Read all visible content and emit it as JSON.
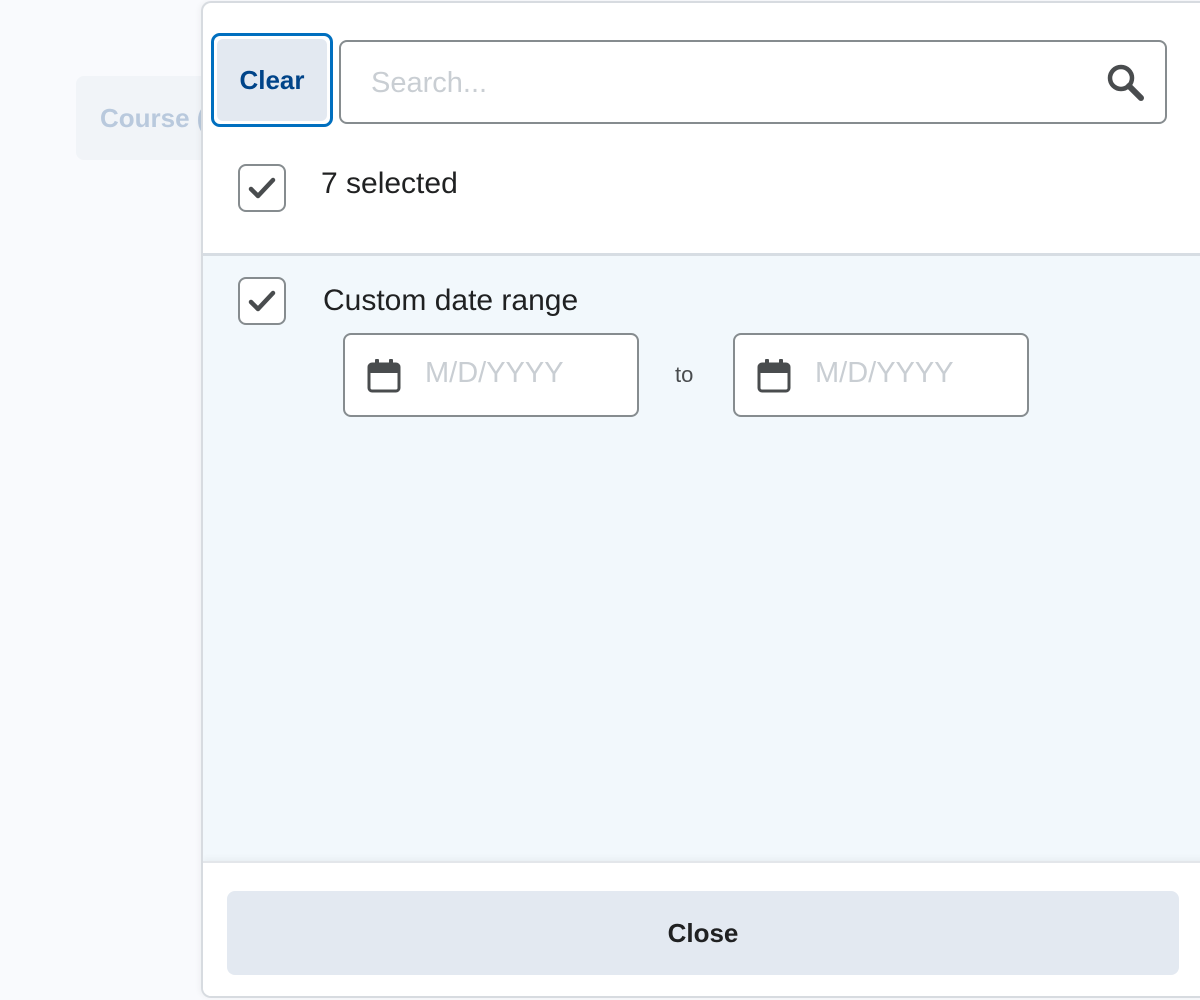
{
  "background": {
    "course_chip_label": "Course ("
  },
  "filter_panel": {
    "clear_label": "Clear",
    "search": {
      "placeholder": "Search...",
      "value": ""
    },
    "select_all": {
      "checked": true,
      "label": "7 selected"
    },
    "options": [
      {
        "label": "Custom date range",
        "checked": true,
        "date_range": {
          "start_placeholder": "M/D/YYYY",
          "start_value": "",
          "separator": "to",
          "end_placeholder": "M/D/YYYY",
          "end_value": ""
        }
      }
    ],
    "close_label": "Close"
  },
  "colors": {
    "focus_ring": "#006fbf",
    "clear_text": "#004489",
    "button_bg": "#e3e9f1",
    "list_bg": "#f2f8fc",
    "text": "#202122",
    "placeholder": "#c9ced3"
  },
  "icons": {
    "search": "search-icon",
    "checkmark": "checkmark-icon",
    "calendar": "calendar-icon"
  }
}
